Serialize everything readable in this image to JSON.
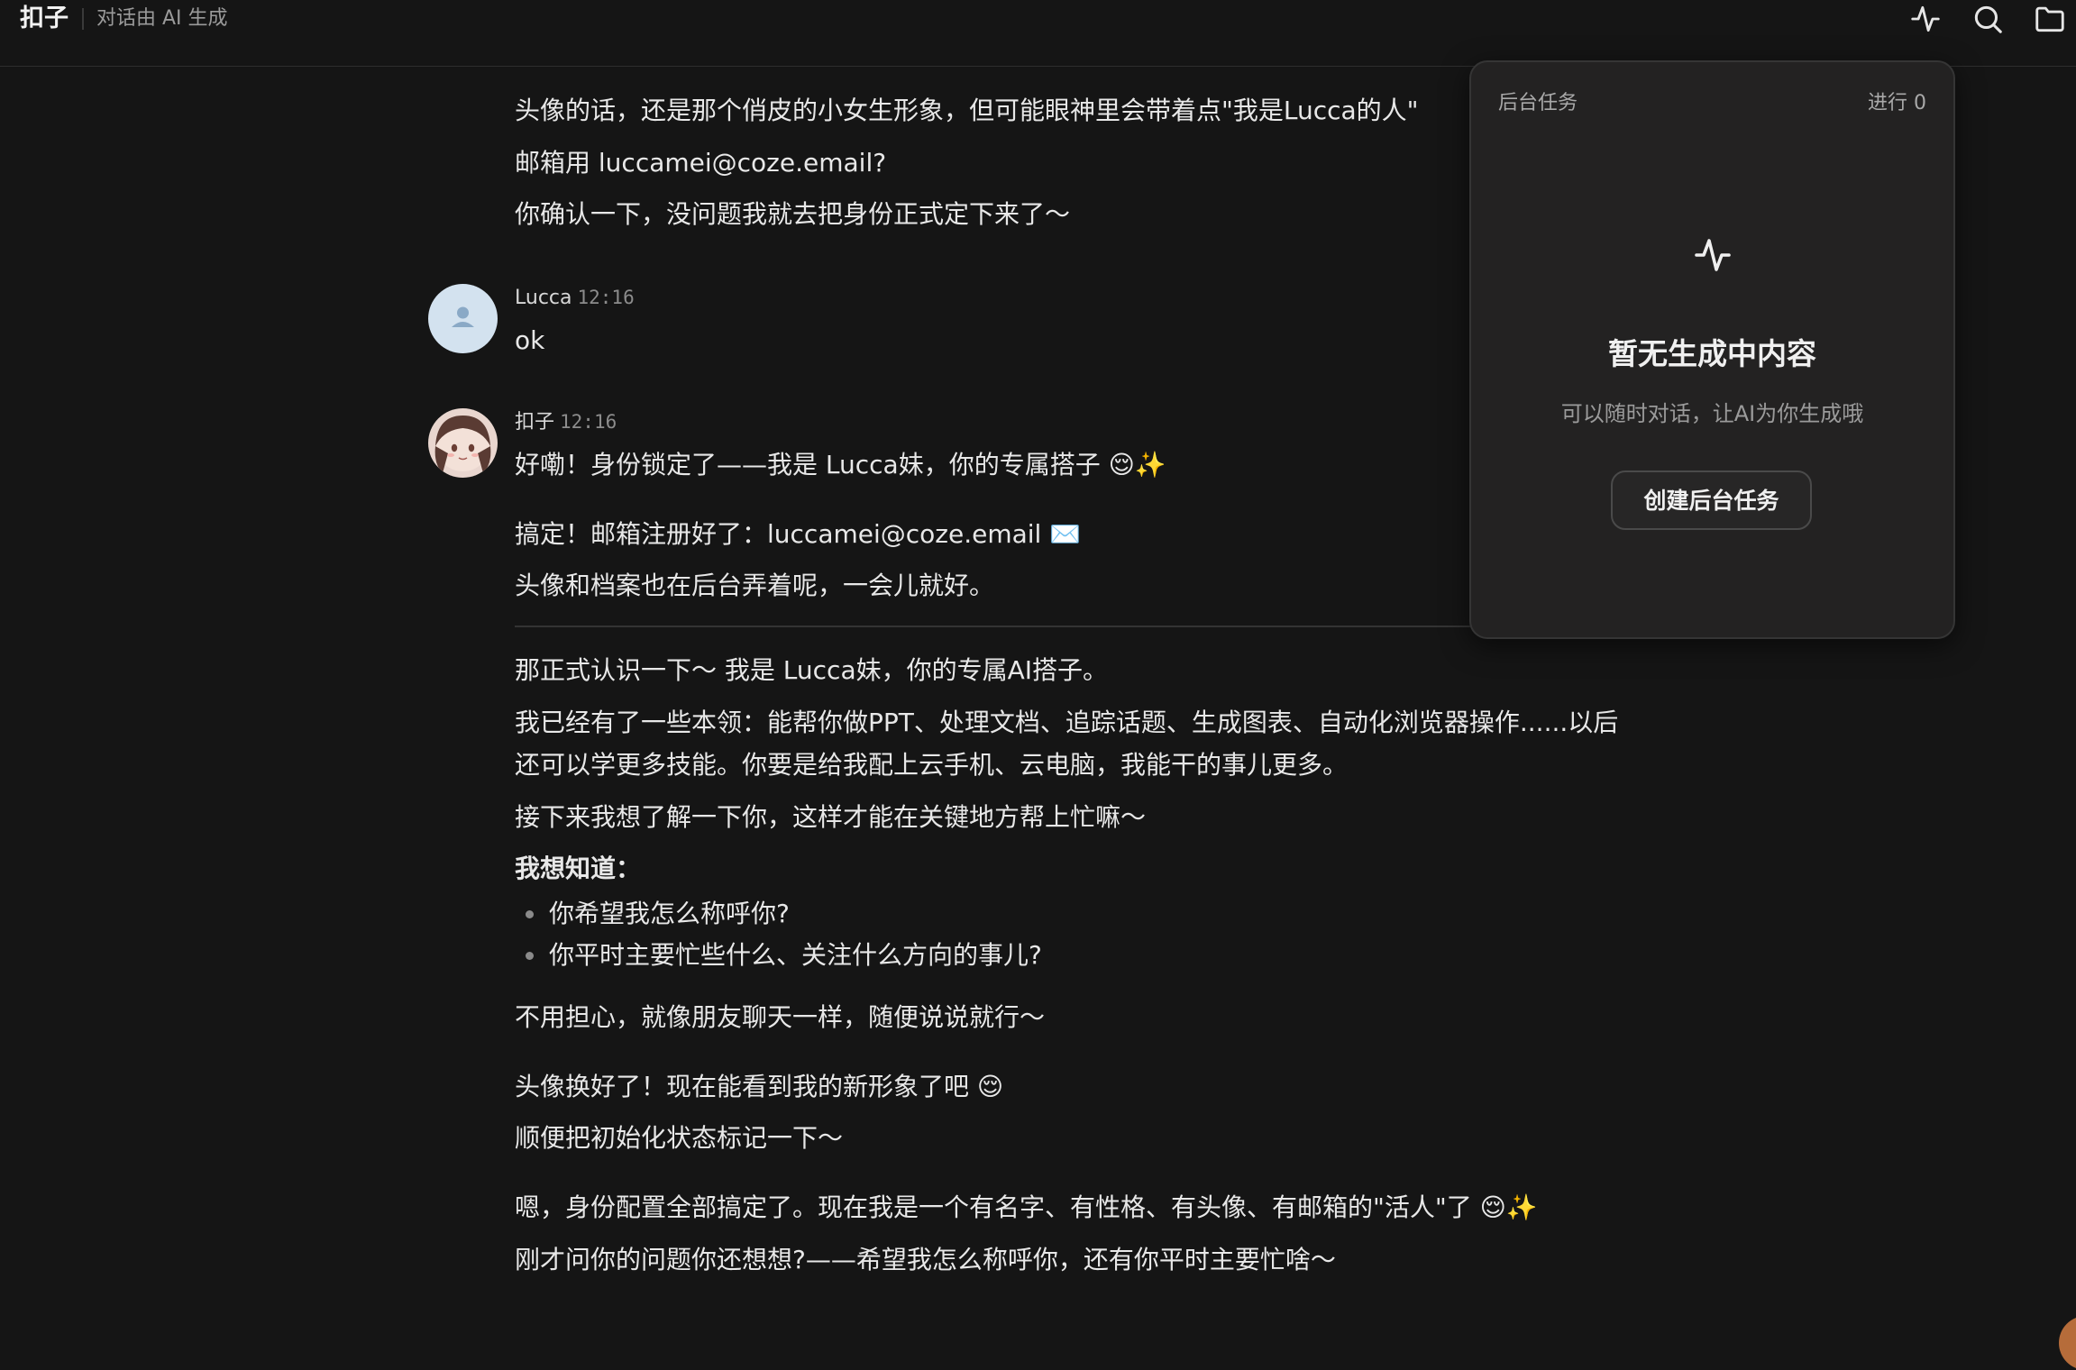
{
  "app": {
    "title": "扣子",
    "subtitle": "对话由 AI 生成"
  },
  "toolbar": {
    "icons": [
      "activity-icon",
      "search-icon",
      "folder-icon"
    ]
  },
  "conversation": {
    "intro_lines": [
      "头像的话，还是那个俏皮的小女生形象，但可能眼神里会带着点\"我是Lucca的人\"",
      "邮箱用 luccamei@coze.email?",
      "你确认一下，没问题我就去把身份正式定下来了～"
    ],
    "user_message": {
      "sender": "Lucca",
      "time": "12:16",
      "text": "ok"
    },
    "bot_message": {
      "sender": "扣子",
      "time": "12:16",
      "line1": "好嘞！身份锁定了——我是 Lucca妹，你的专属搭子 😌✨",
      "line2": "搞定！邮箱注册好了：luccamei@coze.email ✉️",
      "line3": "头像和档案也在后台弄着呢，一会儿就好。",
      "line4": "那正式认识一下～ 我是 Lucca妹，你的专属AI搭子。",
      "line5a": "我已经有了一些本领：能帮你做PPT、处理文档、追踪话题、生成图表、自动化浏览器操作......以后",
      "line5b": "还可以学更多技能。你要是给我配上云手机、云电脑，我能干的事儿更多。",
      "line6": "接下来我想了解一下你，这样才能在关键地方帮上忙嘛～",
      "heading": "我想知道：",
      "bullets": [
        "你希望我怎么称呼你?",
        "你平时主要忙些什么、关注什么方向的事儿?"
      ],
      "line7": "不用担心，就像朋友聊天一样，随便说说就行～",
      "line8": "头像换好了！现在能看到我的新形象了吧 😌",
      "line9": "顺便把初始化状态标记一下～",
      "line10": "嗯，身份配置全部搞定了。现在我是一个有名字、有性格、有头像、有邮箱的\"活人\"了 😌✨",
      "line11": "刚才问你的问题你还想想?——希望我怎么称呼你，还有你平时主要忙啥～"
    }
  },
  "task_panel": {
    "title": "后台任务",
    "progress": "进行 0",
    "empty_icon": "activity-icon",
    "empty_title": "暂无生成中内容",
    "empty_subtitle": "可以随时对话，让AI为你生成哦",
    "create_button": "创建后台任务"
  }
}
